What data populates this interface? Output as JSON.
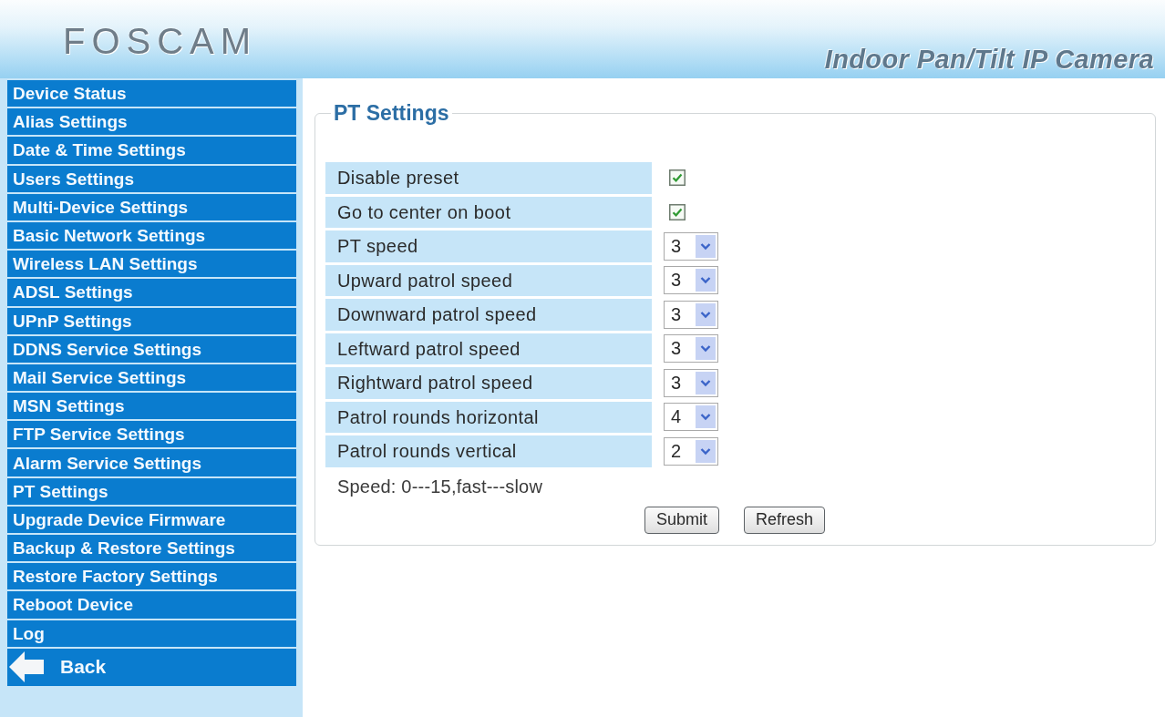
{
  "header": {
    "logo": "FOSCAM",
    "title": "Indoor Pan/Tilt IP Camera"
  },
  "sidebar": {
    "items": [
      "Device Status",
      "Alias Settings",
      "Date & Time Settings",
      "Users Settings",
      "Multi-Device Settings",
      "Basic Network Settings",
      "Wireless LAN Settings",
      "ADSL Settings",
      "UPnP Settings",
      "DDNS Service Settings",
      "Mail Service Settings",
      "MSN Settings",
      "FTP Service Settings",
      "Alarm Service Settings",
      "PT Settings",
      "Upgrade Device Firmware",
      "Backup & Restore Settings",
      "Restore Factory Settings",
      "Reboot Device",
      "Log"
    ],
    "back": "Back"
  },
  "panel": {
    "legend": "PT Settings",
    "rows": [
      {
        "kind": "checkbox",
        "label": "Disable preset",
        "checked": true
      },
      {
        "kind": "checkbox",
        "label": "Go to center on boot",
        "checked": true
      },
      {
        "kind": "select",
        "label": "PT speed",
        "value": "3"
      },
      {
        "kind": "select",
        "label": "Upward patrol speed",
        "value": "3"
      },
      {
        "kind": "select",
        "label": "Downward patrol speed",
        "value": "3"
      },
      {
        "kind": "select",
        "label": "Leftward patrol speed",
        "value": "3"
      },
      {
        "kind": "select",
        "label": "Rightward patrol speed",
        "value": "3"
      },
      {
        "kind": "select",
        "label": "Patrol rounds horizontal",
        "value": "4"
      },
      {
        "kind": "select",
        "label": "Patrol rounds vertical",
        "value": "2"
      }
    ],
    "note": "Speed: 0---15,fast---slow",
    "buttons": [
      "Submit",
      "Refresh"
    ]
  }
}
